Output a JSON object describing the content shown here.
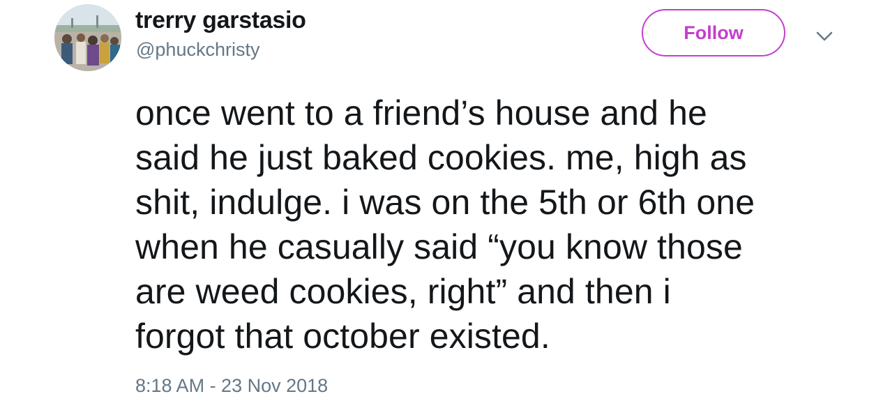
{
  "author": {
    "display_name": "trerry garstasio",
    "handle": "@phuckchristy"
  },
  "header": {
    "follow_label": "Follow",
    "more_icon": "chevron-down-icon"
  },
  "tweet": {
    "lines": [
      "once went to a friend’s house and he",
      "said he just baked cookies. me, high as",
      "shit, indulge. i was on the 5th or 6th one",
      "when he casually said “you know those",
      "are weed cookies, right” and then i",
      "forgot that october existed."
    ],
    "timestamp": "8:18 AM - 23 Nov 2018"
  },
  "colors": {
    "accent": "#c23ecf",
    "text": "#14171a",
    "secondary": "#657786"
  }
}
